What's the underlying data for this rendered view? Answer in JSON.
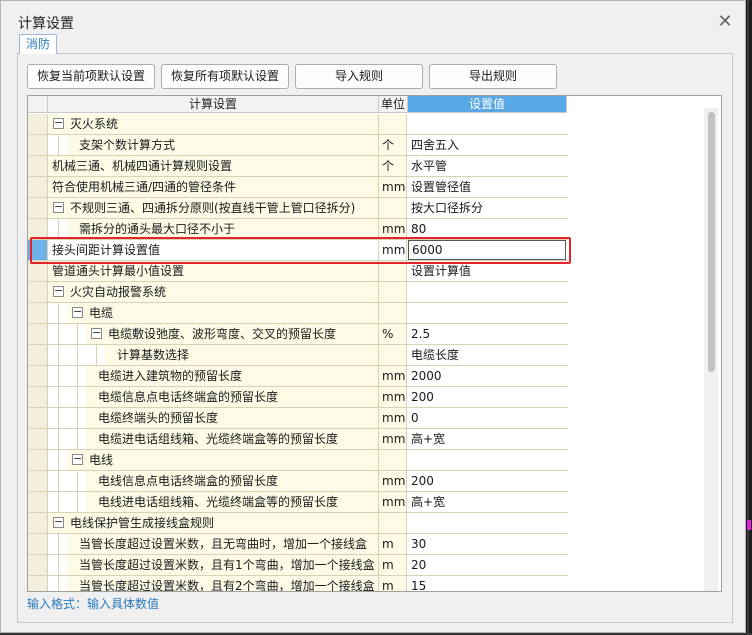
{
  "window": {
    "title": "计算设置",
    "close_glyph": "✕"
  },
  "tab": {
    "label": "消防"
  },
  "buttons": {
    "restore_current": "恢复当前项默认设置",
    "restore_all": "恢复所有项默认设置",
    "import_rules": "导入规则",
    "export_rules": "导出规则"
  },
  "grid": {
    "headers": {
      "name": "计算设置",
      "unit": "单位",
      "value": "设置值"
    },
    "rows": [
      {
        "level": 0,
        "toggle": "−",
        "name": "灭火系统",
        "unit": "",
        "value": ""
      },
      {
        "level": 1,
        "toggle": "",
        "name": "支架个数计算方式",
        "unit": "个",
        "value": "四舍五入"
      },
      {
        "level": 0,
        "toggle": "",
        "name": "机械三通、机械四通计算规则设置",
        "unit": "个",
        "value": "水平管"
      },
      {
        "level": 0,
        "toggle": "",
        "name": "符合使用机械三通/四通的管径条件",
        "unit": "mm",
        "value": "设置管径值"
      },
      {
        "level": 0,
        "toggle": "−",
        "name": "不规则三通、四通拆分原则(按直线干管上管口径拆分)",
        "unit": "",
        "value": "按大口径拆分"
      },
      {
        "level": 1,
        "toggle": "",
        "name": "需拆分的通头最大口径不小于",
        "unit": "mm",
        "value": "80"
      },
      {
        "level": 0,
        "toggle": "",
        "name": "接头间距计算设置值",
        "unit": "mm",
        "value": "6000",
        "selected": true
      },
      {
        "level": 0,
        "toggle": "",
        "name": "管道通头计算最小值设置",
        "unit": "",
        "value": "设置计算值"
      },
      {
        "level": 0,
        "toggle": "−",
        "name": "火灾自动报警系统",
        "unit": "",
        "value": ""
      },
      {
        "level": 1,
        "toggle": "−",
        "name": "电缆",
        "unit": "",
        "value": ""
      },
      {
        "level": 2,
        "toggle": "−",
        "name": "电缆敷设弛度、波形弯度、交叉的预留长度",
        "unit": "%",
        "value": "2.5"
      },
      {
        "level": 3,
        "toggle": "",
        "name": "计算基数选择",
        "unit": "",
        "value": "电缆长度"
      },
      {
        "level": 2,
        "toggle": "",
        "name": "电缆进入建筑物的预留长度",
        "unit": "mm",
        "value": "2000"
      },
      {
        "level": 2,
        "toggle": "",
        "name": "电缆信息点电话终端盒的预留长度",
        "unit": "mm",
        "value": "200"
      },
      {
        "level": 2,
        "toggle": "",
        "name": "电缆终端头的预留长度",
        "unit": "mm",
        "value": "0"
      },
      {
        "level": 2,
        "toggle": "",
        "name": "电缆进电话组线箱、光缆终端盒等的预留长度",
        "unit": "mm",
        "value": "高+宽"
      },
      {
        "level": 1,
        "toggle": "−",
        "name": "电线",
        "unit": "",
        "value": ""
      },
      {
        "level": 2,
        "toggle": "",
        "name": "电线信息点电话终端盒的预留长度",
        "unit": "mm",
        "value": "200"
      },
      {
        "level": 2,
        "toggle": "",
        "name": "电线进电话组线箱、光缆终端盒等的预留长度",
        "unit": "mm",
        "value": "高+宽"
      },
      {
        "level": 0,
        "toggle": "−",
        "name": "电线保护管生成接线盒规则",
        "unit": "",
        "value": ""
      },
      {
        "level": 1,
        "toggle": "",
        "name": "当管长度超过设置米数，且无弯曲时，增加一个接线盒",
        "unit": "m",
        "value": "30"
      },
      {
        "level": 1,
        "toggle": "",
        "name": "当管长度超过设置米数，且有1个弯曲，增加一个接线盒",
        "unit": "m",
        "value": "20"
      },
      {
        "level": 1,
        "toggle": "",
        "name": "当管长度超过设置米数，且有2个弯曲，增加一个接线盒",
        "unit": "m",
        "value": "15"
      }
    ]
  },
  "hint": "输入格式：输入具体数值"
}
